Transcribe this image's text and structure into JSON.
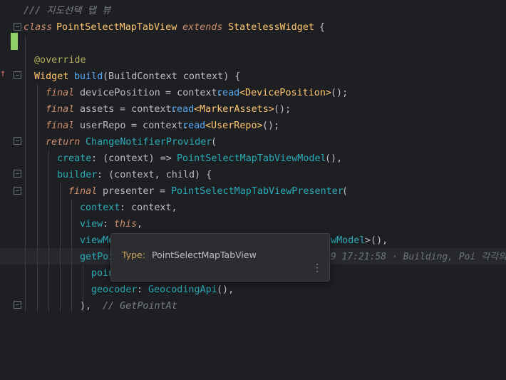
{
  "code": {
    "l0": "/// 지도선택 탭 뷰",
    "l1_kw": "class",
    "l1_name": "PointSelectMapTabView",
    "l1_ext": "extends",
    "l1_super": "StatelessWidget",
    "l1_brace": " {",
    "l3_anno": "@override",
    "l4_type": "Widget",
    "l4_fn": "build",
    "l4_sig": "(BuildContext context) {",
    "l5_kw": "final",
    "l5_var": "devicePosition",
    "l5_eq": " = context.",
    "l5_read": "read",
    "l5_gen": "<DevicePosition>",
    "l5_end": "();",
    "l6_kw": "final",
    "l6_var": "assets",
    "l6_eq": " = context.",
    "l6_read": "read",
    "l6_gen": "<MarkerAssets>",
    "l6_end": "();",
    "l7_kw": "final",
    "l7_var": "userRepo",
    "l7_eq": " = context.",
    "l7_read": "read",
    "l7_gen": "<UserRepo>",
    "l7_end": "();",
    "l8_kw": "return",
    "l8_cls": "ChangeNotifierProvider",
    "l8_end": "(",
    "l9_prop": "create",
    "l9_mid": ": (context) => ",
    "l9_cls": "PointSelectMapTabViewModel",
    "l9_end": "(),",
    "l10_prop": "builder",
    "l10_end": ": (context, child) {",
    "l11_kw": "final",
    "l11_var": "presenter",
    "l11_eq": " = ",
    "l11_cls": "PointSelectMapTabViewPresenter",
    "l11_end": "(",
    "l12_prop": "context",
    "l12_end": ": context,",
    "l13_prop": "view",
    "l13_mid": ": ",
    "l13_kw": "this",
    "l13_end": ",",
    "l14_start": "viewMo",
    "l14_tail_cls": "ewModel",
    "l14_tail": ">(),",
    "l15_start": "getPoi",
    "l16_start": "poin",
    "l17_prop": "geocoder",
    "l17_mid": ": ",
    "l17_cls": "GeocodingApi",
    "l17_end": "(),",
    "l18_end": "),",
    "l18_comment": "// GetPointAt"
  },
  "inlay_hint": "09 17:21:58 · Building, Poi 각각의",
  "popup": {
    "type_label": "Type:",
    "type_value": "PointSelectMapTabView",
    "more_icon": "⋮"
  },
  "colors": {
    "background": "#1e1f22",
    "keyword": "#cf8e6d",
    "class": "#c77dbb",
    "type": "#ffc66d",
    "function": "#56a8f5",
    "change_marker": "#8fd067"
  }
}
